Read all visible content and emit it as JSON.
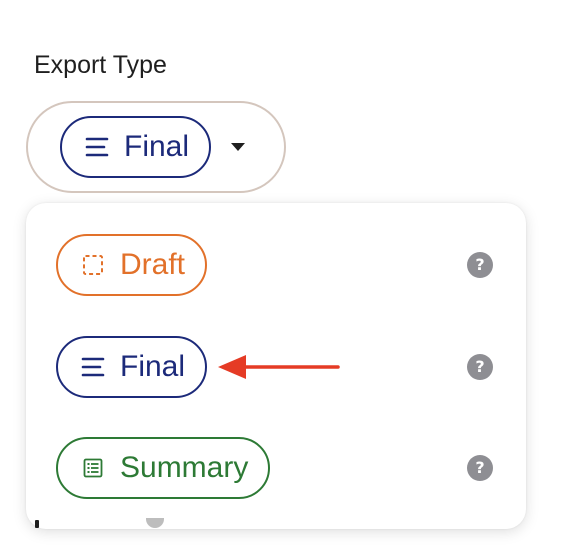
{
  "field": {
    "label": "Export Type",
    "selected": {
      "label": "Final",
      "icon": "lines-icon",
      "color": "#1c2a7a"
    }
  },
  "menu": {
    "options": [
      {
        "label": "Draft",
        "icon": "dashed-square-icon",
        "color": "#e2712a"
      },
      {
        "label": "Final",
        "icon": "lines-icon",
        "color": "#1c2a7a"
      },
      {
        "label": "Summary",
        "icon": "list-box-icon",
        "color": "#2d7a35"
      }
    ],
    "help_icon": "?",
    "help_color": "#8e8e93"
  },
  "annotation": {
    "arrow_color": "#e53b25",
    "target": "Final"
  }
}
